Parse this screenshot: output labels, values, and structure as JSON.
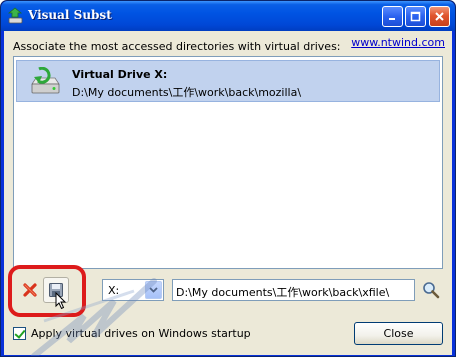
{
  "window": {
    "title": "Visual Subst",
    "icon": "visual-subst-app-icon"
  },
  "titlebar_buttons": [
    "minimize",
    "maximize",
    "close"
  ],
  "header": {
    "description": "Associate the most accessed directories with virtual drives:",
    "link": "www.ntwind.com"
  },
  "drive_list": {
    "items": [
      {
        "name": "Virtual Drive X:",
        "path": "D:\\My documents\\工作\\work\\back\\mozilla\\",
        "selected": true,
        "icon": "virtual-drive-icon"
      }
    ]
  },
  "toolbar": {
    "delete_icon": "red-x-icon",
    "save_icon": "save-disk-icon",
    "drive_letter": "X:",
    "path_value": "D:\\My documents\\工作\\work\\back\\xfile\\",
    "browse_icon": "magnifier-icon"
  },
  "footer": {
    "startup_label": "Apply virtual drives on Windows startup",
    "startup_checked": true,
    "close_label": "Close"
  },
  "colors": {
    "titlebar": "#0054e3",
    "selection": "#c1d2ee",
    "highlight_box": "#dd1b1b",
    "link": "#0000cc"
  }
}
